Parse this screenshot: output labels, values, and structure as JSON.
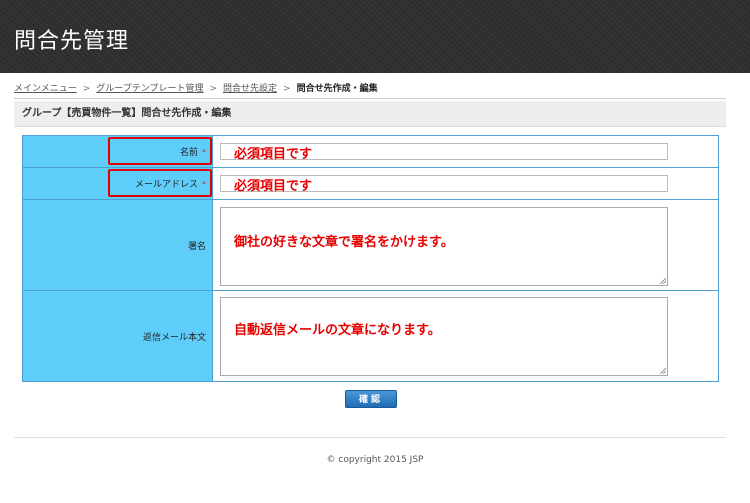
{
  "header": {
    "title": "問合先管理"
  },
  "breadcrumb": {
    "items": [
      "メインメニュー",
      "グループテンプレート管理",
      "問合せ先設定"
    ],
    "separator": ">",
    "current": "問合せ先作成・編集"
  },
  "section": {
    "title": "グループ【売買物件一覧】問合せ先作成・編集"
  },
  "form": {
    "required_mark": "*",
    "name": {
      "label": "名前",
      "value": ""
    },
    "email": {
      "label": "メールアドレス",
      "value": ""
    },
    "signature": {
      "label": "署名",
      "value": ""
    },
    "auto_reply": {
      "label": "返信メール本文",
      "value": ""
    }
  },
  "annotations": {
    "required": "必須項目です",
    "signature_note": "御社の好きな文章で署名をかけます。",
    "auto_reply_note": "自動返信メールの文章になります。"
  },
  "buttons": {
    "confirm": "確認"
  },
  "footer": {
    "copyright": "© copyright 2015 JSP"
  },
  "colors": {
    "header_bg": "#2f2f2f",
    "label_bg": "#5fcdfa",
    "border": "#4d9fd0",
    "annotation_red": "#e60000",
    "button_blue": "#2a7cc4"
  }
}
